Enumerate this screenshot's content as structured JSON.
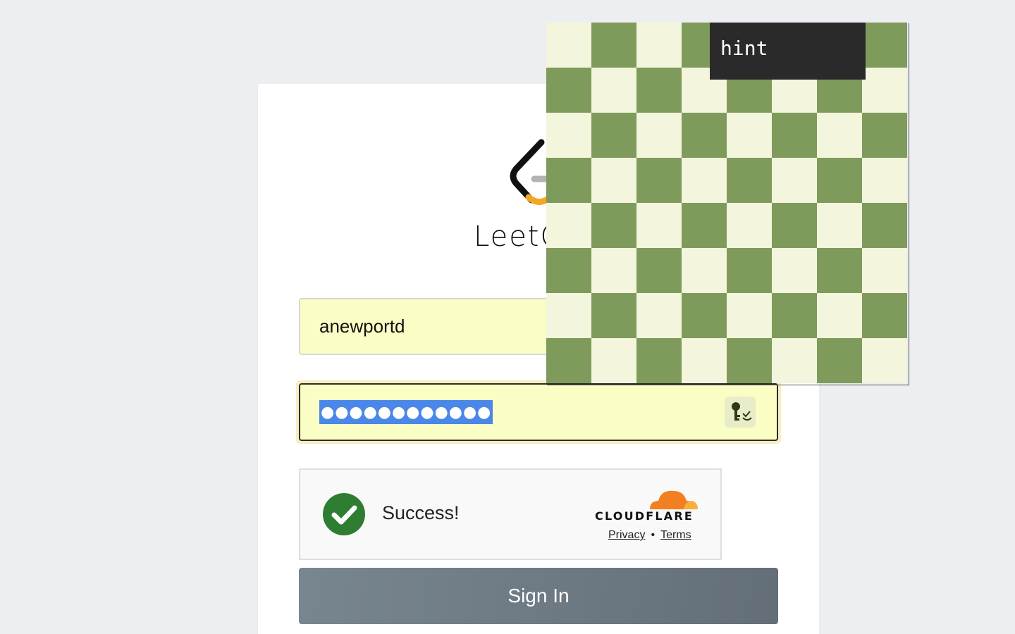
{
  "brand": {
    "name": "LeetCode",
    "wordmark_visible": "LeetC",
    "colors": {
      "logo_orange": "#f5a623",
      "logo_black": "#111111",
      "logo_gray": "#b3b3b3"
    }
  },
  "login": {
    "username_value": "anewportd",
    "password_mask": "●●●●●●●●●●●●",
    "password_manager_icon": "key-check-icon",
    "field_autofill_color": "#fafec4"
  },
  "captcha": {
    "status_text": "Success!",
    "status_icon": "check-circle-icon",
    "status_color": "#2f7d32",
    "provider": "CLOUDFLARE",
    "privacy_label": "Privacy",
    "separator": "•",
    "terms_label": "Terms"
  },
  "actions": {
    "signin_label": "Sign In"
  },
  "overlay": {
    "hint_label": "hint",
    "board_colors": {
      "light": "#f3f5dc",
      "dark": "#7f9b5b"
    }
  }
}
